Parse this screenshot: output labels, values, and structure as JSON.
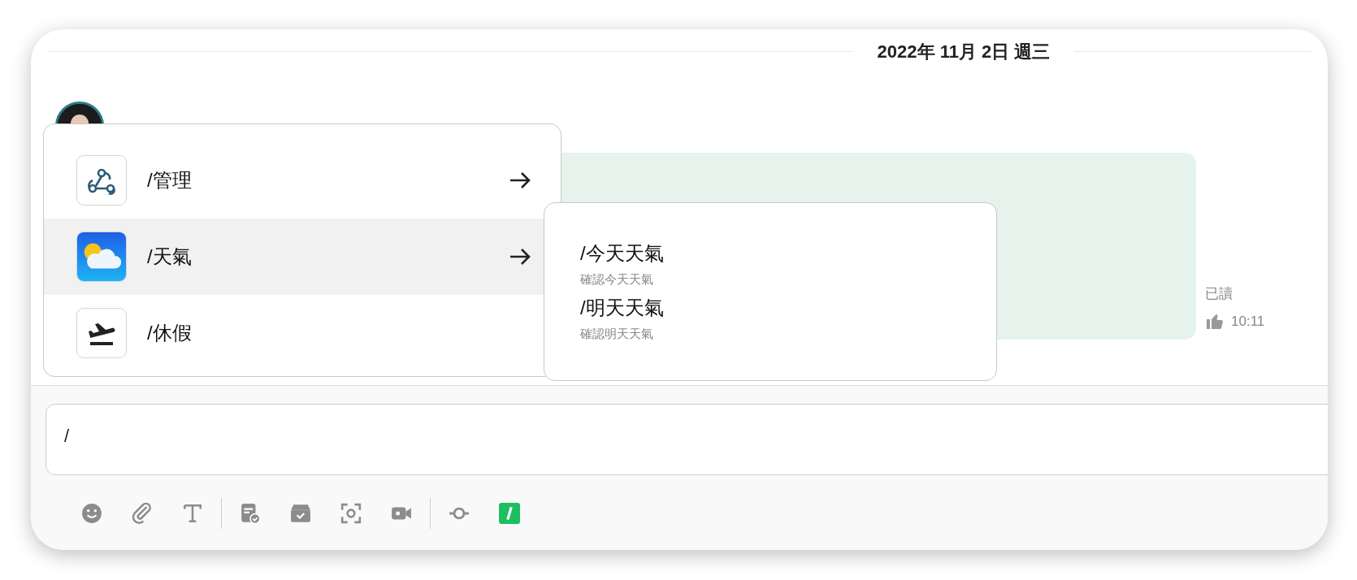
{
  "date_separator": "2022年 11月 2日 週三",
  "message": {
    "read_status": "已讀",
    "time": "10:11"
  },
  "command_menu": {
    "items": [
      {
        "label": "/管理",
        "kind": "webhook",
        "selected": false,
        "has_submenu": true
      },
      {
        "label": "/天氣",
        "kind": "weather",
        "selected": true,
        "has_submenu": true
      },
      {
        "label": "/休假",
        "kind": "departure",
        "selected": false,
        "has_submenu": false
      }
    ]
  },
  "submenu": {
    "items": [
      {
        "command": "/今天天氣",
        "description": "確認今天天氣"
      },
      {
        "command": "/明天天氣",
        "description": "確認明天天氣"
      }
    ]
  },
  "composer": {
    "value": "/"
  },
  "toolbar": [
    {
      "kind": "emoji"
    },
    {
      "kind": "attach"
    },
    {
      "kind": "text"
    },
    {
      "kind": "separator"
    },
    {
      "kind": "task"
    },
    {
      "kind": "archive"
    },
    {
      "kind": "screenshot"
    },
    {
      "kind": "video"
    },
    {
      "kind": "separator"
    },
    {
      "kind": "commit"
    },
    {
      "kind": "slash"
    }
  ]
}
